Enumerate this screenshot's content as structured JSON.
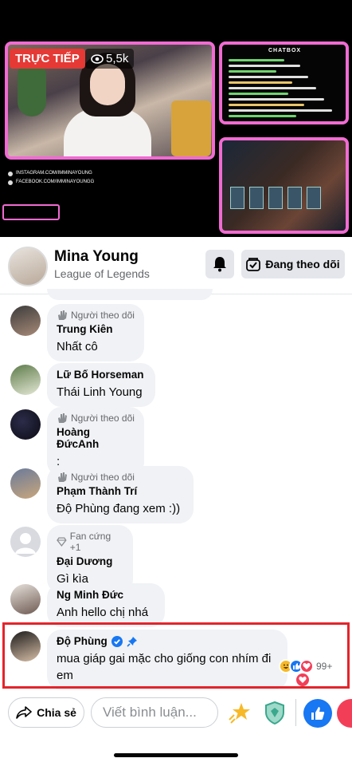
{
  "video": {
    "live_label": "TRỰC TIẾP",
    "views": "5,5k",
    "social_links": [
      "INSTAGRAM.COM/IMMINAYOUNG",
      "FACEBOOK.COM/IMMINAYOUNGG"
    ],
    "chatbox_title": "CHATBOX",
    "accent_color": "#f06bd2"
  },
  "streamer": {
    "name": "Mina Young",
    "game": "League of Legends",
    "follow_label": "Đang theo dõi"
  },
  "comments": [
    {
      "badge": "Người theo dõi",
      "name": "Trung Kiên",
      "text": "Nhất cô"
    },
    {
      "badge": "",
      "name": "Lữ Bố Horseman",
      "text": "Thái Linh Young"
    },
    {
      "badge": "Người theo dõi",
      "name": "Hoàng ĐứcAnh",
      "text": ":"
    },
    {
      "badge": "Người theo dõi",
      "name": "Phạm Thành Trí",
      "text": "Độ Phùng đang xem :))"
    },
    {
      "badge": "Fan cứng +1",
      "name": "Đại Dương",
      "text": "Gì kìa"
    },
    {
      "badge": "",
      "name": "Ng Minh Đức",
      "text": " Anh hello chị nhá"
    },
    {
      "badge": "",
      "name": "Độ Phùng",
      "text": "mua giáp gai mặc cho giống con nhím đi em",
      "reaction_count": "99+",
      "pinned": true,
      "verified": true
    }
  ],
  "composer": {
    "share_label": "Chia sẻ",
    "placeholder": "Viết bình luận..."
  },
  "colors": {
    "highlight_border": "#e3242b",
    "facebook_blue": "#1877f2",
    "live_red": "#e53935"
  }
}
